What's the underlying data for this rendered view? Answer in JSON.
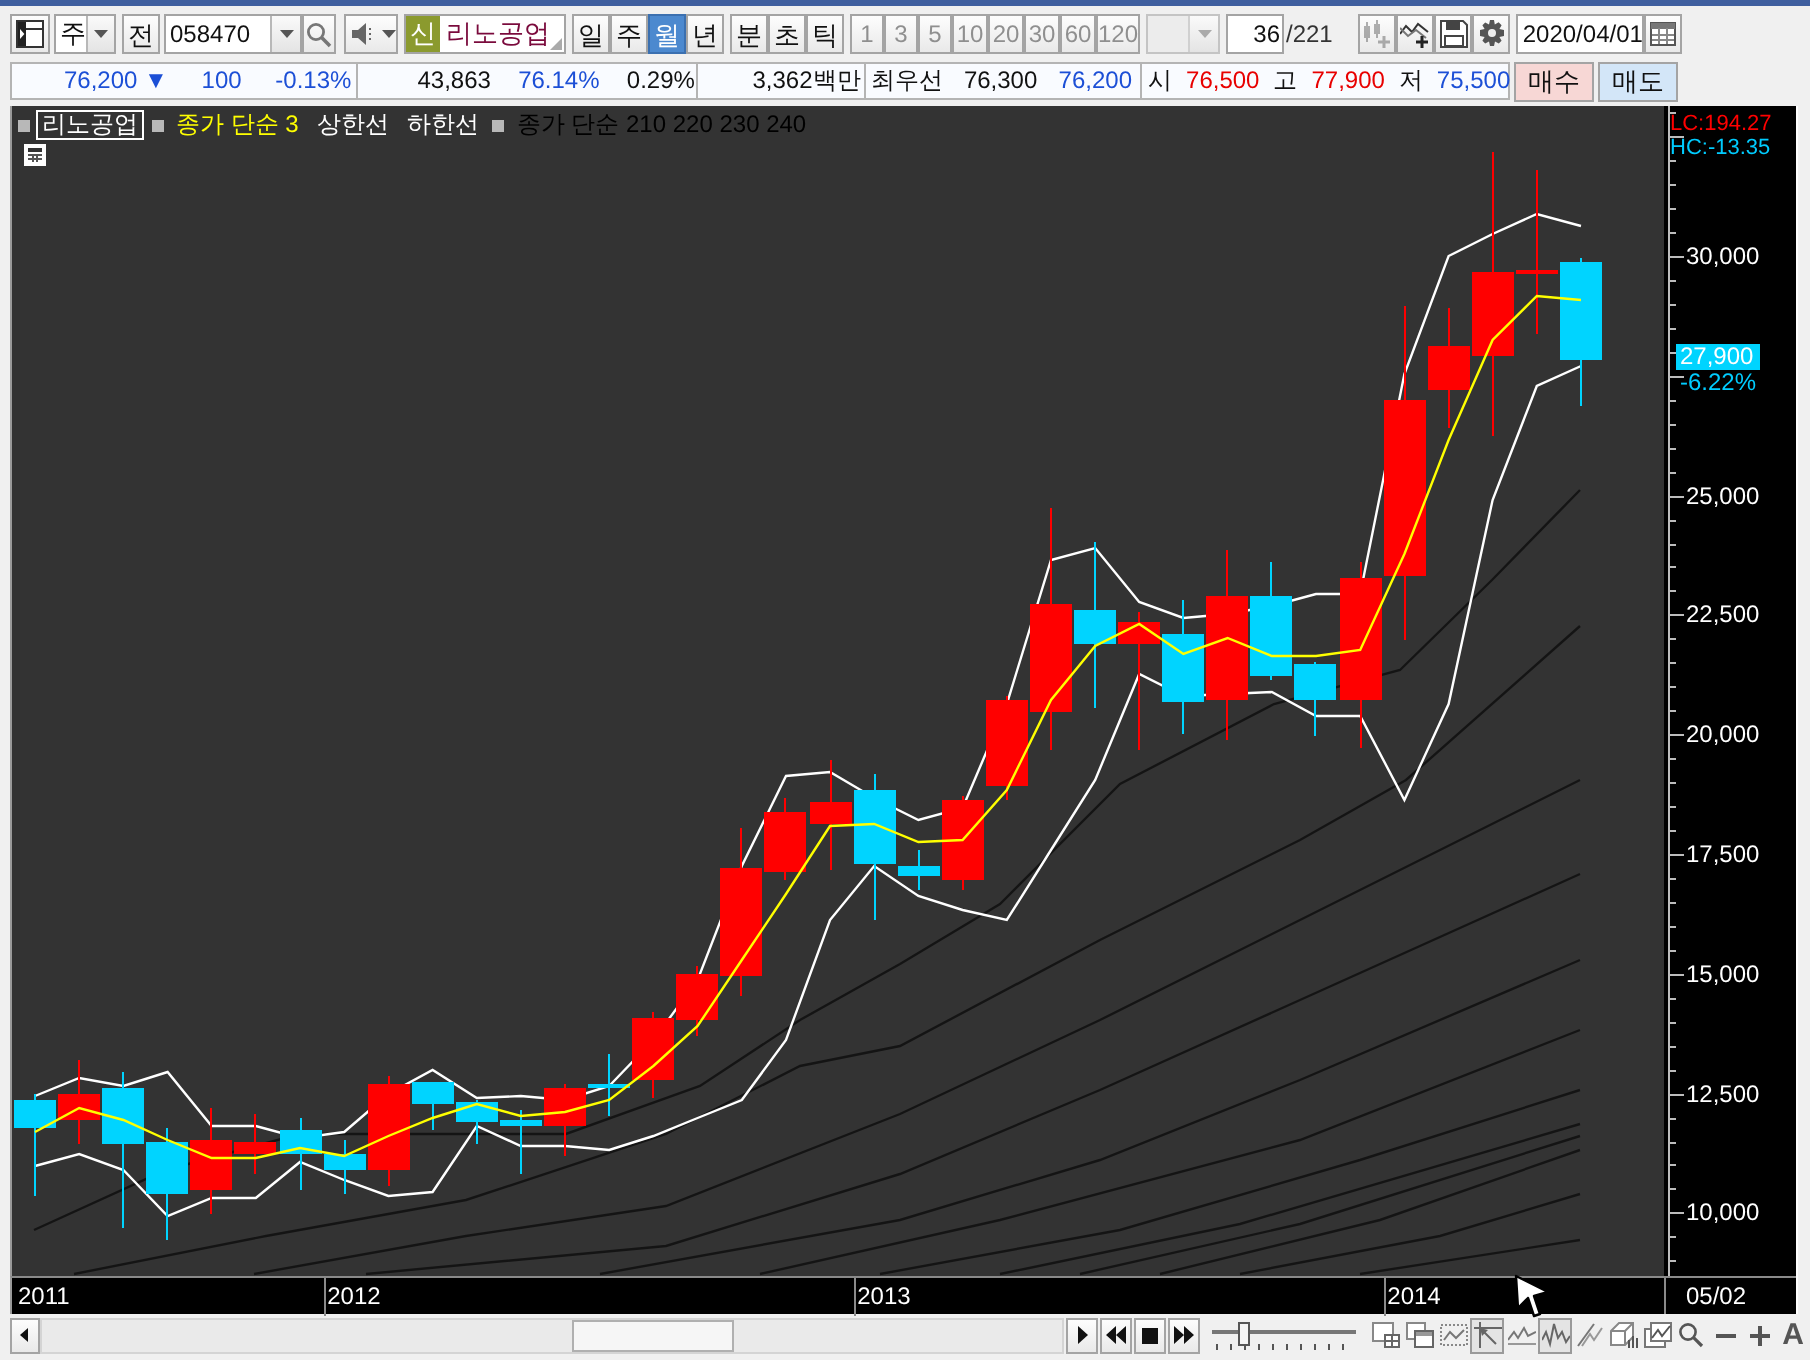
{
  "toolbar": {
    "period_dropdown": {
      "value": "주"
    },
    "prev_button": "전",
    "code_field": {
      "value": "058470"
    },
    "stock": {
      "tag": "신",
      "name": "리노공업"
    },
    "period_tabs": [
      {
        "label": "일",
        "selected": false
      },
      {
        "label": "주",
        "selected": false
      },
      {
        "label": "월",
        "selected": true
      },
      {
        "label": "년",
        "selected": false
      }
    ],
    "time_buttons": [
      "분",
      "초",
      "틱"
    ],
    "interval_buttons": [
      {
        "label": "1",
        "disabled": true
      },
      {
        "label": "3",
        "disabled": true
      },
      {
        "label": "5",
        "disabled": true
      },
      {
        "label": "10",
        "disabled": true
      },
      {
        "label": "20",
        "disabled": true
      },
      {
        "label": "30",
        "disabled": true
      },
      {
        "label": "60",
        "disabled": true
      },
      {
        "label": "120",
        "disabled": true
      }
    ],
    "unit_dropdown": {
      "disabled": true
    },
    "count_field": {
      "value": "36"
    },
    "count_total": "/221",
    "tool_buttons": [
      {
        "kind": "add-candle",
        "disabled": true
      },
      {
        "kind": "add-line",
        "disabled": false
      },
      {
        "kind": "save",
        "disabled": false
      },
      {
        "kind": "settings",
        "disabled": false
      }
    ],
    "date_field": {
      "value": "2020/04/01"
    }
  },
  "quote_bar": {
    "groups": [
      {
        "items": [
          {
            "kind": "value",
            "text": "76,200 ▼",
            "color": "#1c4fd6"
          },
          {
            "kind": "value",
            "text": "100",
            "color": "#1c4fd6"
          },
          {
            "kind": "value",
            "text": "-0.13%",
            "color": "#1c4fd6"
          }
        ]
      },
      {
        "items": [
          {
            "kind": "value",
            "text": "43,863",
            "color": "#111111"
          },
          {
            "kind": "value",
            "text": "76.14%",
            "color": "#1c4fd6"
          },
          {
            "kind": "value",
            "text": "0.29%",
            "color": "#111111"
          }
        ]
      },
      {
        "items": [
          {
            "kind": "value",
            "text": "3,362백만",
            "color": "#111111"
          }
        ]
      },
      {
        "items": [
          {
            "kind": "label",
            "text": "최우선"
          },
          {
            "kind": "value",
            "text": "76,300",
            "color": "#111111"
          },
          {
            "kind": "value",
            "text": "76,200",
            "color": "#1c4fd6"
          }
        ]
      },
      {
        "items": [
          {
            "kind": "label",
            "text": "시"
          },
          {
            "kind": "value",
            "text": "76,500",
            "color": "#e80000"
          },
          {
            "kind": "label",
            "text": "고"
          },
          {
            "kind": "value",
            "text": "77,900",
            "color": "#e80000"
          },
          {
            "kind": "label",
            "text": "저"
          },
          {
            "kind": "value",
            "text": "75,500",
            "color": "#1c4fd6"
          }
        ]
      }
    ]
  },
  "order_buttons": [
    {
      "label": "매수",
      "kind": "buy"
    },
    {
      "label": "매도",
      "kind": "sell"
    }
  ],
  "chart": {
    "legend": [
      {
        "selected": true,
        "entries": [
          {
            "label": "리노공업",
            "color": "#ffffff"
          }
        ]
      },
      {
        "selected": false,
        "entries": [
          {
            "label": "종가 단순 3",
            "color": "#ffff00"
          },
          {
            "label": "상한선",
            "color": "#ffffff"
          },
          {
            "label": "하한선",
            "color": "#ffffff"
          }
        ]
      },
      {
        "selected": false,
        "entries": [
          {
            "label": "종가 단순 210 220 230 240",
            "color": "#000000"
          }
        ]
      }
    ],
    "indicators": [
      {
        "text": "LC:194.27",
        "color": "#ff0000"
      },
      {
        "text": "HC:-13.35",
        "color": "#00ccff"
      }
    ],
    "current_price": {
      "value": "27,900",
      "change": "-6.22%"
    },
    "y_axis": {
      "labels": [
        "30,000",
        "25,000",
        "22,500",
        "20,000",
        "17,500",
        "15,000",
        "12,500",
        "10,000"
      ]
    },
    "x_axis": {
      "labels": [
        "2011",
        "2012",
        "2013",
        "2014"
      ],
      "end_label": "05/02"
    }
  },
  "bottom_bar": {
    "zoom_slider": {
      "level": 0.2
    },
    "font_button": "A"
  }
}
